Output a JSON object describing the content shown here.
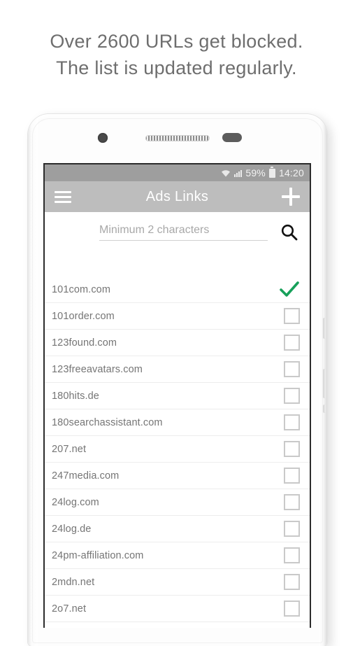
{
  "headline": {
    "line1": "Over 2600 URLs get blocked.",
    "line2": "The list is updated regularly."
  },
  "device": {
    "hardware": {
      "camera": "camera-dot",
      "speaker": "speaker-grille",
      "sensor": "sensor-pill"
    }
  },
  "status_bar": {
    "wifi_icon": "wifi-icon",
    "signal_icon": "signal-bars-icon",
    "battery_percent": "59%",
    "battery_icon": "battery-icon",
    "time": "14:20",
    "background": "#9e9e9e"
  },
  "toolbar": {
    "menu_icon": "hamburger-menu-icon",
    "title": "Ads Links",
    "add_icon": "plus-icon",
    "background": "#bdbdbd"
  },
  "search": {
    "placeholder": "Minimum 2 characters",
    "value": "",
    "search_icon": "search-icon"
  },
  "list": {
    "selected_color": "#17a05a",
    "checkbox_color": "#c9c9c9",
    "items": [
      {
        "label": "101com.com",
        "checked": true
      },
      {
        "label": "101order.com",
        "checked": false
      },
      {
        "label": "123found.com",
        "checked": false
      },
      {
        "label": "123freeavatars.com",
        "checked": false
      },
      {
        "label": "180hits.de",
        "checked": false
      },
      {
        "label": "180searchassistant.com",
        "checked": false
      },
      {
        "label": "207.net",
        "checked": false
      },
      {
        "label": "247media.com",
        "checked": false
      },
      {
        "label": "24log.com",
        "checked": false
      },
      {
        "label": "24log.de",
        "checked": false
      },
      {
        "label": "24pm-affiliation.com",
        "checked": false
      },
      {
        "label": "2mdn.net",
        "checked": false
      },
      {
        "label": "2o7.net",
        "checked": false
      }
    ]
  }
}
